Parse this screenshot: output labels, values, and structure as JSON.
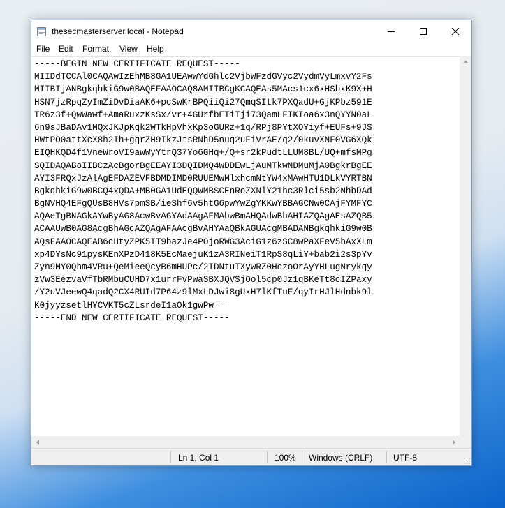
{
  "window": {
    "title": "thesecmasterserver.local - Notepad"
  },
  "menu": [
    "File",
    "Edit",
    "Format",
    "View",
    "Help"
  ],
  "content": {
    "lines": [
      "-----BEGIN NEW CERTIFICATE REQUEST-----",
      "MIIDdTCCAl0CAQAwIzEhMB8GA1UEAwwYdGhlc2VjbWFzdGVyc2VydmVyLmxvY2Fs",
      "MIIBIjANBgkqhkiG9w0BAQEFAAOCAQ8AMIIBCgKCAQEAs5MAcs1cx6xHSbxK9X+H",
      "HSN7jzRpqZyImZiDvDiaAK6+pcSwKrBPQiiQi27QmqSItk7PXQadU+GjKPbz591E",
      "TR6z3f+QwWawf+AmaRuxzKsSx/vr+4GUrfbETiTji73QamLFIKIoa6x3nQYYN0aL",
      "6n9sJBaDAv1MQxJKJpKqk2WTkHpVhxKp3oGURz+1q/RPj8PYtXOYiyf+EUFs+9JS",
      "HWtPO0attXcX8h2Ih+gqrZH9IkzJtsRNhD5nuq2uFiVrAE/q2/0kuvXNF0VG6XQk",
      "EIQHKQD4f1VneWroVI9awWyYtrQ37Yo6GHq+/Q+sr2kPudtLLUM8BL/UQ+mfsMPg",
      "SQIDAQABoIIBCzAcBgorBgEEAYI3DQIDMQ4WDDEwLjAuMTkwNDMuMjA0BgkrBgEE",
      "AYI3FRQxJzAlAgEFDAZEVFBDMDIMD0RUUEMwMlxhcmNtYW4xMAwHTU1DLkVYRTBN",
      "BgkqhkiG9w0BCQ4xQDA+MB0GA1UdEQQWMBSCEnRoZXNlY21hc3Rlci5sb2NhbDAd",
      "BgNVHQ4EFgQUsB8HVs7pmSB/ieShf6v5htG6pwYwZgYKKwYBBAGCNw0CAjFYMFYC",
      "AQAeTgBNAGkAYwByAG8AcwBvAGYAdAAgAFMAbwBmAHQAdwBhAHIAZQAgAEsAZQB5",
      "ACAAUwB0AG8AcgBhAGcAZQAgAFAAcgBvAHYAaQBkAGUAcgMBADANBgkqhkiG9w0B",
      "AQsFAAOCAQEAB6cHtyZPK5IT9bazJe4POjoRWG3AciG1z6zSC8wPaXFeV5bAxXLm",
      "xp4DYsNc91pysKEnXPzD418K5EcMaejuK1zA3RINeiT1RpS8qLiY+bab2i2s3pYv",
      "Zyn9MY0Qhm4VRu+QeMieeQcyB6mHUPc/2IDNtuTXywRZ0HczoOrAyYHLugNrykqy",
      "zVw3EezvaVfTbRMbuCUHD7x1urrFvPwaSBXJQVSjOol5cp0Jz1qBKeTt8cIZPaxy",
      "/Y2uVJeewQ4qadQ2CX4RUId7P64z9lMxLDJwi8gUxH7lKfTuF/qyIrHJlHdnbk9l",
      "K0jyyzsetlHYCVKT5cZLsrdeI1aOk1gwPw==",
      "-----END NEW CERTIFICATE REQUEST-----"
    ]
  },
  "statusbar": {
    "position": "Ln 1, Col 1",
    "zoom": "100%",
    "line_ending": "Windows (CRLF)",
    "encoding": "UTF-8"
  },
  "icons": {
    "app": "notepad-icon",
    "minimize": "minimize-icon",
    "maximize": "maximize-icon",
    "close": "close-icon"
  }
}
